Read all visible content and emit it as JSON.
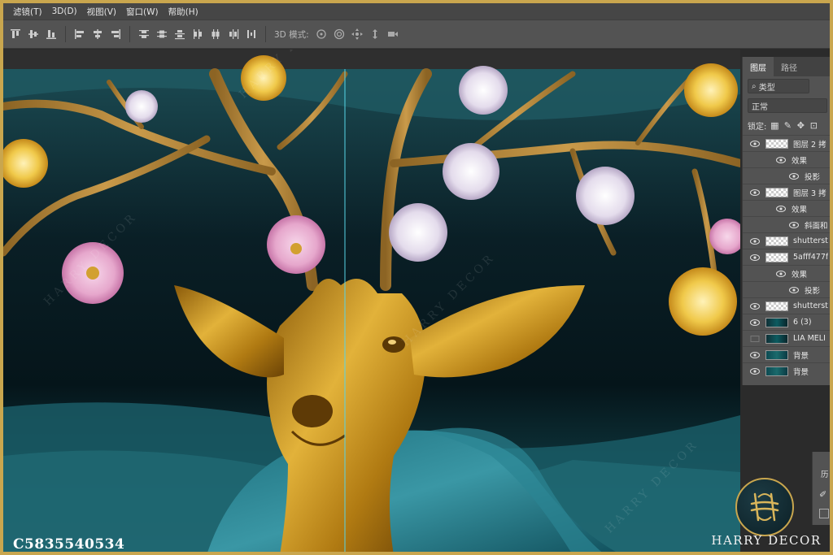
{
  "menu": [
    "滤镜(T)",
    "3D(D)",
    "视图(V)",
    "窗口(W)",
    "帮助(H)"
  ],
  "options_bar": {
    "mode_label": "3D 模式:",
    "align_icons": [
      "align-top-icon",
      "align-vcenter-icon",
      "align-bottom-icon",
      "align-left-icon",
      "align-hcenter-icon",
      "align-right-icon"
    ],
    "distribute_icons": [
      "distribute-top-icon",
      "distribute-vcenter-icon",
      "distribute-bottom-icon",
      "distribute-left-icon",
      "distribute-hcenter-icon",
      "distribute-right-icon",
      "distribute-space-icon"
    ],
    "mode3d_icons": [
      "rotate-3d-icon",
      "roll-3d-icon",
      "pan-3d-icon",
      "slide-3d-icon",
      "scale-3d-icon"
    ]
  },
  "layers_panel": {
    "tabs": [
      "图层",
      "路径"
    ],
    "filter_label": "类型",
    "blend_mode": "正常",
    "lock_label": "锁定:",
    "layers": [
      {
        "name": "图层 2 拷",
        "level": 0,
        "thumb": "check",
        "visible": true
      },
      {
        "name": "效果",
        "level": 1,
        "thumb": "none",
        "visible": true
      },
      {
        "name": "投影",
        "level": 2,
        "thumb": "none",
        "visible": true
      },
      {
        "name": "图层 3 拷",
        "level": 0,
        "thumb": "check",
        "visible": true
      },
      {
        "name": "效果",
        "level": 1,
        "thumb": "none",
        "visible": true
      },
      {
        "name": "斜面和",
        "level": 2,
        "thumb": "none",
        "visible": true
      },
      {
        "name": "shutterst",
        "level": 0,
        "thumb": "check",
        "visible": true
      },
      {
        "name": "5afff477f",
        "level": 0,
        "thumb": "check",
        "visible": true
      },
      {
        "name": "效果",
        "level": 1,
        "thumb": "none",
        "visible": true
      },
      {
        "name": "投影",
        "level": 2,
        "thumb": "none",
        "visible": true
      },
      {
        "name": "shutterst",
        "level": 0,
        "thumb": "check",
        "visible": true
      },
      {
        "name": "6 (3)",
        "level": 0,
        "thumb": "tealdark",
        "visible": true
      },
      {
        "name": "LIA MELI",
        "level": 0,
        "thumb": "tealdark",
        "visible": false
      },
      {
        "name": "背景",
        "level": 0,
        "thumb": "teal",
        "visible": true
      },
      {
        "name": "背景",
        "level": 0,
        "thumb": "teal",
        "visible": true
      }
    ]
  },
  "history_panel": {
    "label": "历"
  },
  "watermark": "HARRY DECOR",
  "brand": {
    "name": "HARRY DECOR"
  },
  "image_code": "C5835540534",
  "colors": {
    "frame": "#c9a64e",
    "bg_teal": "#0e2c33",
    "gold": "#c8901a",
    "branch": "#b78a3a"
  }
}
